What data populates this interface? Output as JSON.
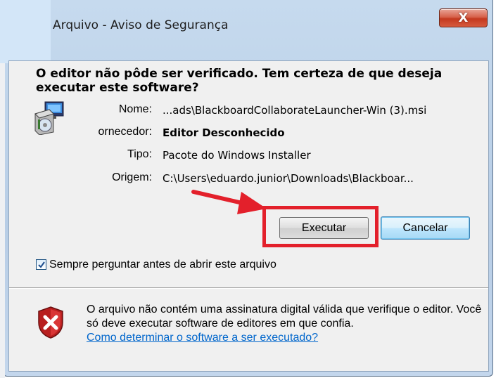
{
  "window": {
    "title": "Arquivo - Aviso de Segurança",
    "close_label": "X"
  },
  "dialog": {
    "question": "O editor não pôde ser verificado. Tem certeza de que deseja executar este software?",
    "fields": {
      "name_label": "Nome:",
      "name_value": "...ads\\BlackboardCollaborateLauncher-Win (3).msi",
      "publisher_label": "ornecedor:",
      "publisher_value": "Editor Desconhecido",
      "type_label": "Tipo:",
      "type_value": "Pacote do Windows Installer",
      "from_label": "Origem:",
      "from_value": "C:\\Users\\eduardo.junior\\Downloads\\Blackboar..."
    },
    "buttons": {
      "run": "Executar",
      "cancel": "Cancelar"
    },
    "checkbox": {
      "label": "Sempre perguntar antes de abrir este arquivo",
      "checked": true
    },
    "warning": {
      "text": "O arquivo não contém uma assinatura digital válida que verifique o editor. Você só deve executar software de editores em que confia.",
      "link": "Como determinar o software a ser executado?"
    }
  },
  "icons": {
    "package": "installer-package-icon",
    "shield": "security-shield-warning-icon",
    "arrow": "red-arrow-annotation"
  },
  "colors": {
    "highlight": "#e3202b",
    "link": "#0066cc",
    "close_button": "#c4391f"
  }
}
